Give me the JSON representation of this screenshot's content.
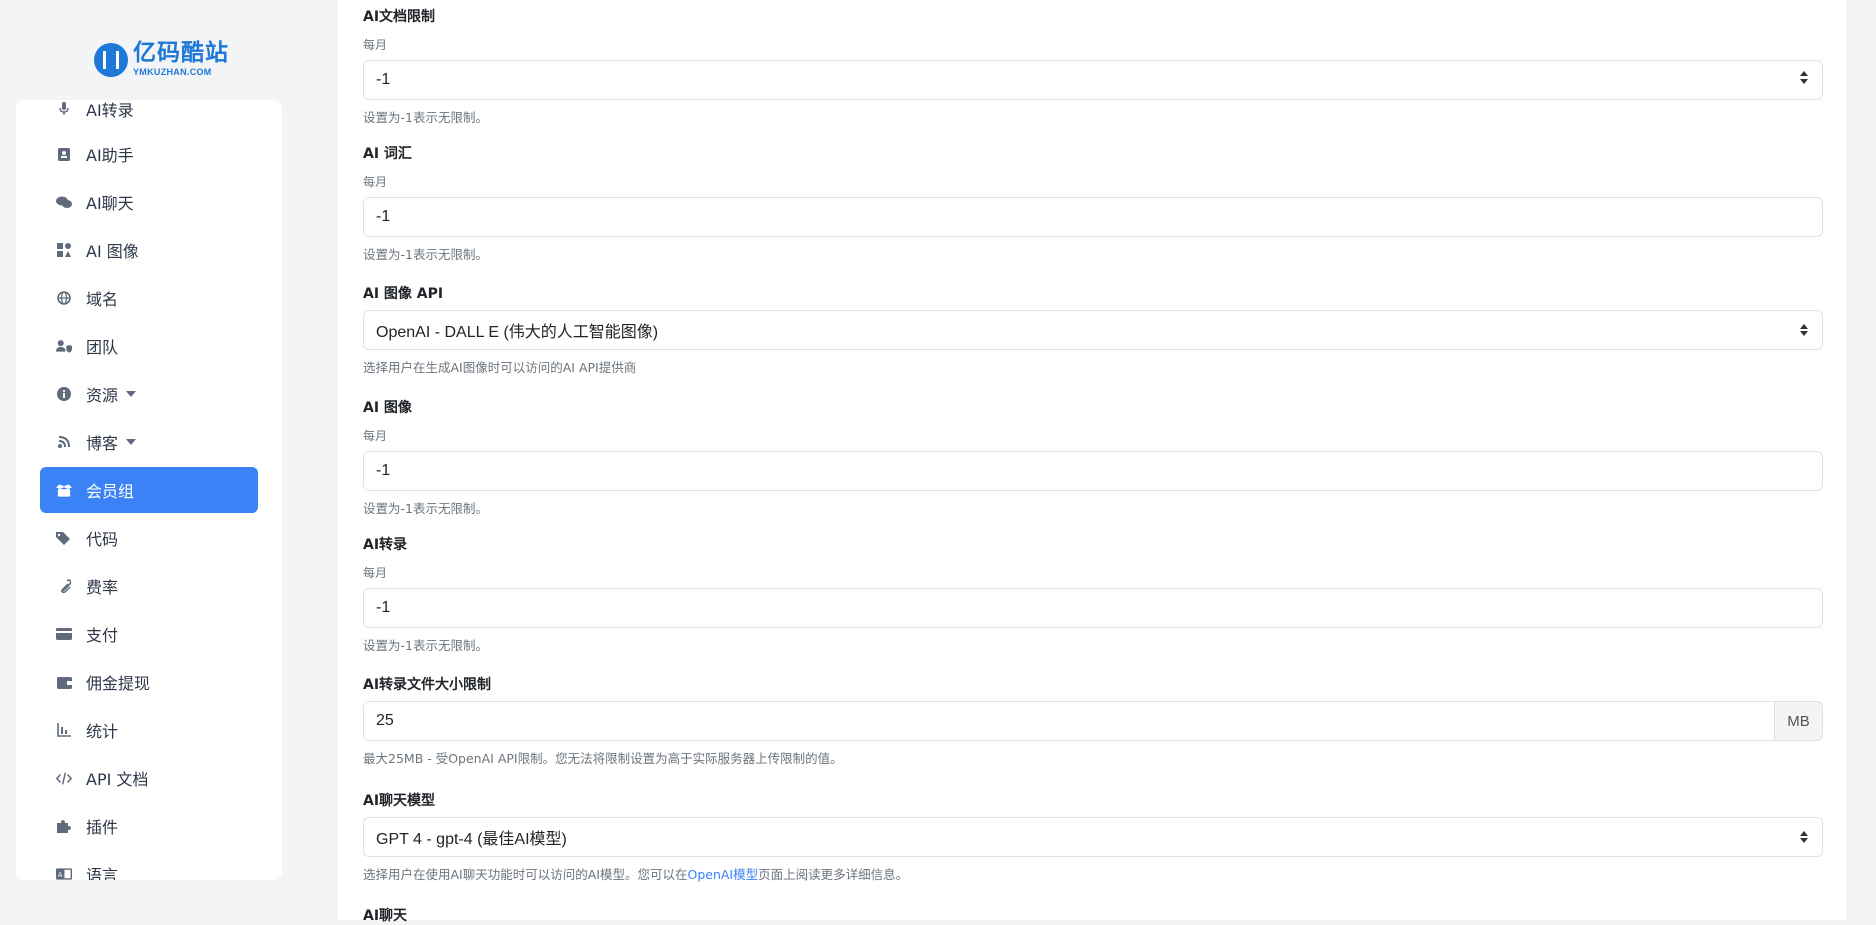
{
  "logo": {
    "cn": "亿码酷站",
    "en": "YMKUZHAN.COM"
  },
  "sidebar": {
    "items": [
      {
        "label": "AI转录",
        "icon": "microphone-icon"
      },
      {
        "label": "AI助手",
        "icon": "id-badge-icon"
      },
      {
        "label": "AI聊天",
        "icon": "comments-icon"
      },
      {
        "label": "AI 图像",
        "icon": "image-icon"
      },
      {
        "label": "域名",
        "icon": "globe-icon"
      },
      {
        "label": "团队",
        "icon": "user-shield-icon"
      },
      {
        "label": "资源",
        "icon": "info-circle-icon"
      },
      {
        "label": "博客",
        "icon": "blog-icon"
      },
      {
        "label": "会员组",
        "icon": "box-open-icon"
      },
      {
        "label": "代码",
        "icon": "tags-icon"
      },
      {
        "label": "费率",
        "icon": "paperclip-icon"
      },
      {
        "label": "支付",
        "icon": "credit-card-icon"
      },
      {
        "label": "佣金提现",
        "icon": "wallet-icon"
      },
      {
        "label": "统计",
        "icon": "chart-bar-icon"
      },
      {
        "label": "API 文档",
        "icon": "code-icon"
      },
      {
        "label": "插件",
        "icon": "puzzle-icon"
      },
      {
        "label": "语言",
        "icon": "language-icon"
      }
    ],
    "active_color": "#3b82f6"
  },
  "form": {
    "doc_limit": {
      "label": "AI文档限制",
      "sub": "每月",
      "value": "-1",
      "help": "设置为-1表示无限制。"
    },
    "words": {
      "label": "AI 词汇",
      "sub": "每月",
      "value": "-1",
      "help": "设置为-1表示无限制。"
    },
    "image_api": {
      "label": "AI 图像 API",
      "value": "OpenAI - DALL E (伟大的人工智能图像)",
      "help": "选择用户在生成AI图像时可以访问的AI API提供商"
    },
    "images": {
      "label": "AI 图像",
      "sub": "每月",
      "value": "-1",
      "help": "设置为-1表示无限制。"
    },
    "transcriptions": {
      "label": "AI转录",
      "sub": "每月",
      "value": "-1",
      "help": "设置为-1表示无限制。"
    },
    "transcription_size": {
      "label": "AI转录文件大小限制",
      "value": "25",
      "unit": "MB",
      "help": "最大25MB - 受OpenAI API限制。您无法将限制设置为高于实际服务器上传限制的值。"
    },
    "chat_model": {
      "label": "AI聊天模型",
      "value": "GPT 4 - gpt-4 (最佳AI模型)",
      "help_before": "选择用户在使用AI聊天功能时可以访问的AI模型。您可以在",
      "help_link": "OpenAI模型",
      "help_after": "页面上阅读更多详细信息。"
    },
    "chats": {
      "label": "AI聊天"
    }
  }
}
